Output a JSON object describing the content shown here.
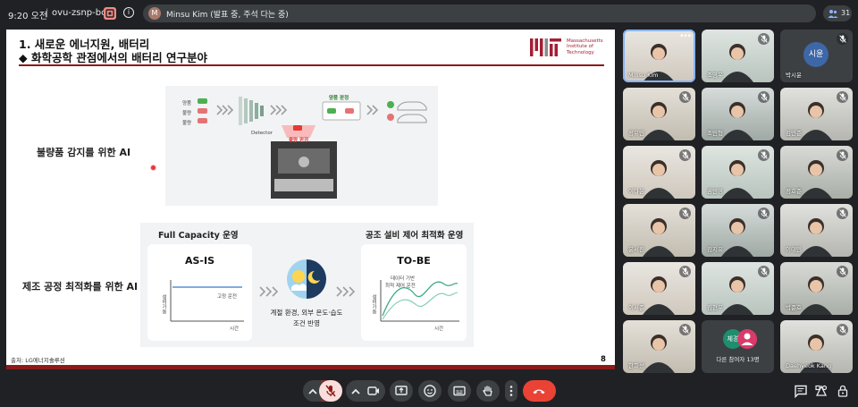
{
  "topbar": {
    "time": "9:20 오전",
    "separator": "|",
    "meeting_code": "ovu-zsnp-bce",
    "presenter_initial": "M",
    "presenter_text": "Minsu Kim (발표 중, 주석 다는 중)",
    "participant_count": "31"
  },
  "slide": {
    "title": "1. 새로운 에너지원, 배터리",
    "subtitle": "◆  화학공학 관점에서의 배터리 연구분야",
    "mit_text": [
      "Massachusetts",
      "Institute of",
      "Technology"
    ],
    "section1_label": "불량품 감지를 위한 AI",
    "section2_label": "제조 공정 최적화를 위한 AI",
    "panel1": {
      "rows": [
        "양품",
        "불량",
        "불량"
      ],
      "detector": "Detector",
      "defect_tag": "불량 판정",
      "good_tag": "양품 판정"
    },
    "panel2": {
      "head_left": "Full Capacity 운영",
      "head_right": "공조 설비 제어 최적화 운영",
      "asis_title": "AS-IS",
      "asis_line": "고정 운전",
      "asis_yaxis": "설비가동",
      "asis_xaxis": "시간",
      "tobe_title": "TO-BE",
      "tobe_line1": "데이터 기반",
      "tobe_line2": "최적 제어 운전",
      "tobe_yaxis": "설비가동",
      "tobe_xaxis": "시간",
      "middle_caption1": "계절 환경, 외부 온도·습도",
      "middle_caption2": "조건 반영"
    },
    "source": "출처: LG에너지솔루션",
    "page_number": "8"
  },
  "participants": [
    {
      "name": "Minsu Kim",
      "kind": "video",
      "active": true,
      "muted": false
    },
    {
      "name": "조영우",
      "kind": "video",
      "muted": true
    },
    {
      "name": "박시윤",
      "kind": "avatar",
      "initials": "시윤",
      "muted": true
    },
    {
      "name": "정유민",
      "kind": "video",
      "muted": true
    },
    {
      "name": "조민형",
      "kind": "video",
      "muted": true
    },
    {
      "name": "김민준",
      "kind": "video",
      "muted": true
    },
    {
      "name": "이다은",
      "kind": "video",
      "muted": true
    },
    {
      "name": "권민영",
      "kind": "video",
      "muted": true
    },
    {
      "name": "정호준",
      "kind": "video",
      "muted": true
    },
    {
      "name": "윤서진",
      "kind": "video",
      "muted": true
    },
    {
      "name": "김지유",
      "kind": "video",
      "muted": true
    },
    {
      "name": "이태민",
      "kind": "video",
      "muted": true
    },
    {
      "name": "이서준",
      "kind": "video",
      "muted": true
    },
    {
      "name": "김현우",
      "kind": "video",
      "muted": true
    },
    {
      "name": "박준호",
      "kind": "video",
      "muted": true
    },
    {
      "name": "한희성",
      "kind": "video",
      "muted": true
    },
    {
      "name": "다른 참여자 13명",
      "kind": "others",
      "initials": "체경",
      "muted": false
    },
    {
      "name": "Daehyeok Kang",
      "kind": "video",
      "muted": true
    }
  ],
  "colors": {
    "background": "#202124",
    "control": "#3c4043",
    "hangup": "#ea4335",
    "mic_off": "#f9dedc",
    "slide_accent": "#8b1a1a",
    "mit_red": "#a31f34",
    "active_speaker": "#8ab4f8"
  },
  "icons": [
    "recording-icon",
    "info-icon",
    "people-icon",
    "chevron-up-icon",
    "mic-off-icon",
    "camera-icon",
    "present-icon",
    "emoji-icon",
    "captions-icon",
    "raise-hand-icon",
    "more-vert-icon",
    "hangup-icon",
    "chat-icon",
    "activities-icon",
    "host-controls-icon"
  ]
}
